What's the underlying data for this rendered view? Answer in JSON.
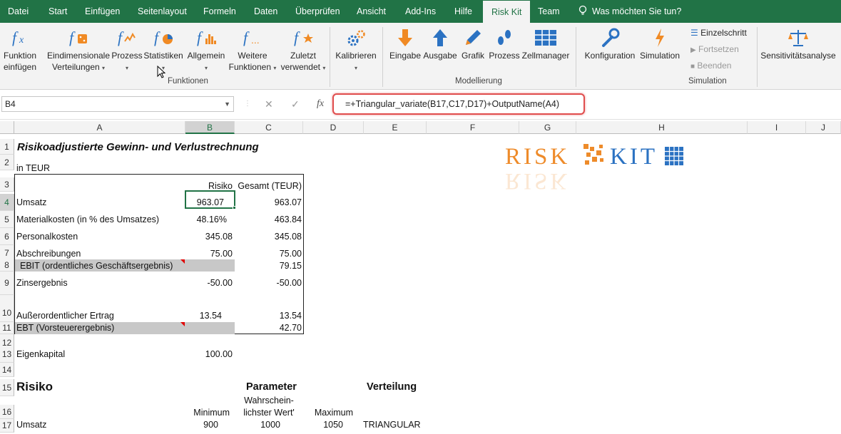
{
  "ribbon_tabs": [
    "Datei",
    "Start",
    "Einfügen",
    "Seitenlayout",
    "Formeln",
    "Daten",
    "Überprüfen",
    "Ansicht",
    "Add-Ins",
    "Hilfe",
    "Risk Kit",
    "Team"
  ],
  "tell_me": "Was möchten Sie tun?",
  "ribbon": {
    "funktion": [
      "Funktion",
      "einfügen"
    ],
    "eindim": [
      "Eindimensionale",
      "Verteilungen"
    ],
    "prozess": "Prozess",
    "statistiken": "Statistiken",
    "allgemein": "Allgemein",
    "weitere": [
      "Weitere",
      "Funktionen"
    ],
    "zuletzt": [
      "Zuletzt",
      "verwendet"
    ],
    "kalibrieren": "Kalibrieren",
    "group_funktionen": "Funktionen",
    "eingabe": "Eingabe",
    "ausgabe": "Ausgabe",
    "grafik": "Grafik",
    "prozess2": "Prozess",
    "zellmanager": "Zellmanager",
    "group_modellierung": "Modellierung",
    "konfiguration": "Konfiguration",
    "simulation": "Simulation",
    "einzelschritt": "Einzelschritt",
    "fortsetzen": "Fortsetzen",
    "beenden": "Beenden",
    "group_simulation": "Simulation",
    "sensitivitaet": "Sensitivitätsanalyse"
  },
  "formula_bar": {
    "name_box": "B4",
    "formula": "=+Triangular_variate(B17,C17,D17)+OutputName(A4)"
  },
  "columns": [
    "A",
    "B",
    "C",
    "D",
    "E",
    "F",
    "G",
    "H",
    "I",
    "J"
  ],
  "rows": [
    "1",
    "2",
    "3",
    "4",
    "5",
    "6",
    "7",
    "8",
    "9",
    "10",
    "11",
    "12",
    "13",
    "14",
    "15",
    "16",
    "17"
  ],
  "logo": {
    "text1": "RISK",
    "text2": "KIT"
  },
  "sheet": {
    "title": "Risikoadjustierte Gewinn- und Verlustrechnung",
    "unit": "in TEUR",
    "hdr_risiko": "Risiko",
    "hdr_gesamt": "Gesamt (TEUR)",
    "r4": [
      "Umsatz",
      "963.07",
      "963.07"
    ],
    "r5": [
      "Materialkosten (in % des Umsatzes)",
      "48.16%",
      "463.84"
    ],
    "r6": [
      "Personalkosten",
      "345.08",
      "345.08"
    ],
    "r7": [
      "Abschreibungen",
      "75.00",
      "75.00"
    ],
    "r8": [
      "EBIT (ordentliches Geschäftsergebnis)",
      "79.15"
    ],
    "r9": [
      "Zinsergebnis",
      "-50.00",
      "-50.00"
    ],
    "r10": [
      "Außerordentlicher Ertrag",
      "13.54",
      "13.54"
    ],
    "r11": [
      "EBT (Vorsteuerergebnis)",
      "42.70"
    ],
    "r13": [
      "Eigenkapital",
      "100.00"
    ],
    "r15": [
      "Risiko",
      "Parameter",
      "Verteilung"
    ],
    "r16_min": "Minimum",
    "r16_wahr1": "Wahrschein-",
    "r16_wahr2": "lichster Wert'",
    "r16_max": "Maximum",
    "r17": [
      "Umsatz",
      "900",
      "1000",
      "1050",
      "TRIANGULAR"
    ]
  }
}
